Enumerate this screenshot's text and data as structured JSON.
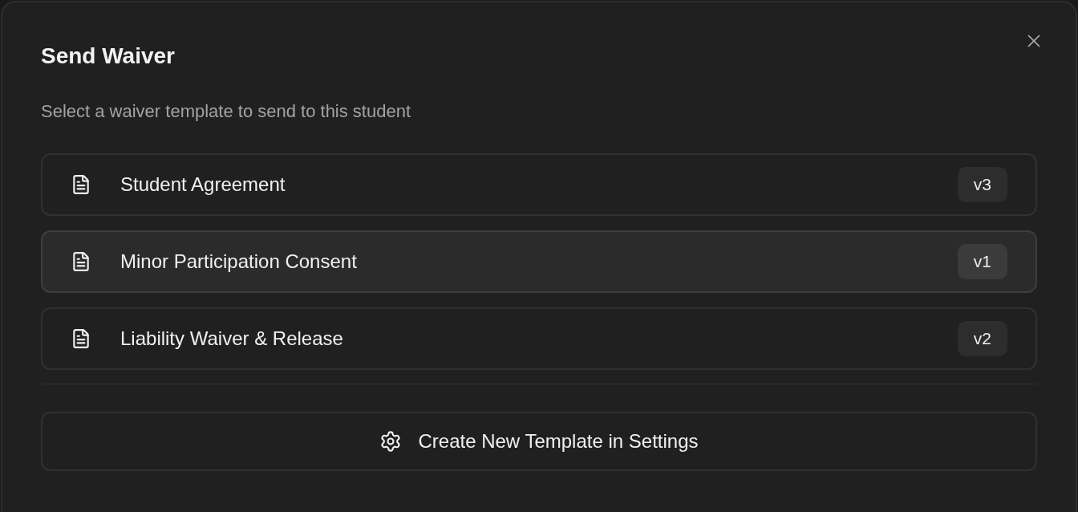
{
  "dialog": {
    "title": "Send Waiver",
    "subtitle": "Select a waiver template to send to this student"
  },
  "templates": [
    {
      "name": "Student Agreement",
      "version": "v3",
      "selected": false
    },
    {
      "name": "Minor Participation Consent",
      "version": "v1",
      "selected": true
    },
    {
      "name": "Liability Waiver & Release",
      "version": "v2",
      "selected": false
    }
  ],
  "action_button": {
    "label": "Create New Template in Settings"
  }
}
